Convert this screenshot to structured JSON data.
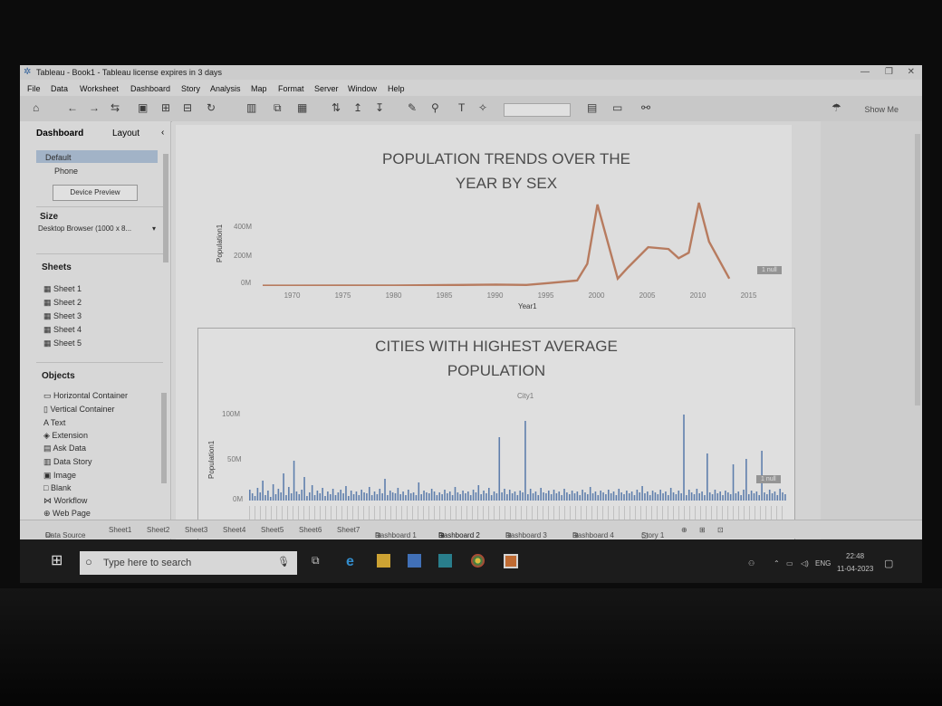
{
  "window": {
    "title": "Tableau - Book1 - Tableau license expires in 3 days"
  },
  "menu": [
    "File",
    "Data",
    "Worksheet",
    "Dashboard",
    "Story",
    "Analysis",
    "Map",
    "Format",
    "Server",
    "Window",
    "Help"
  ],
  "toolbar": {
    "show_me": "Show Me"
  },
  "left_panel": {
    "tab_dashboard": "Dashboard",
    "tab_layout": "Layout",
    "devices": [
      "Default",
      "Phone"
    ],
    "device_preview": "Device Preview",
    "size_header": "Size",
    "size_value": "Desktop Browser (1000 x 8...",
    "sheets_header": "Sheets",
    "sheets": [
      "Sheet 1",
      "Sheet 2",
      "Sheet 3",
      "Sheet 4",
      "Sheet 5"
    ],
    "objects_header": "Objects",
    "objects": [
      "Horizontal Container",
      "Vertical Container",
      "Text",
      "Extension",
      "Ask Data",
      "Data Story",
      "Image",
      "Blank",
      "Workflow",
      "Web Page"
    ]
  },
  "chart1": {
    "title_line1": "POPULATION TRENDS OVER THE",
    "title_line2": "YEAR BY SEX",
    "y_label": "Population1",
    "x_label": "Year1",
    "y_ticks": [
      "400M",
      "200M",
      "0M"
    ],
    "x_ticks": [
      "1970",
      "1975",
      "1980",
      "1985",
      "1990",
      "1995",
      "2000",
      "2005",
      "2010",
      "2015"
    ],
    "null_badge": "1 null"
  },
  "chart2": {
    "title_line1": "CITIES WITH HIGHEST AVERAGE",
    "title_line2": "POPULATION",
    "header_label": "City1",
    "y_label": "Population1",
    "y_ticks": [
      "100M",
      "50M",
      "0M"
    ],
    "null_badge": "1 null"
  },
  "chart_data": [
    {
      "type": "line",
      "title": "POPULATION TRENDS OVER THE YEAR BY SEX",
      "xlabel": "Year1",
      "ylabel": "Population1",
      "ylim": [
        0,
        450000000
      ],
      "xlim": [
        1967,
        2017
      ],
      "x": [
        1967,
        1970,
        1975,
        1980,
        1985,
        1990,
        1993,
        1995,
        1998,
        1999,
        2000,
        2002,
        2003,
        2005,
        2007,
        2008,
        2009,
        2010,
        2011,
        2013
      ],
      "values": [
        2000000,
        2000000,
        3000000,
        3000000,
        5000000,
        8000000,
        6000000,
        15000000,
        30000000,
        120000000,
        440000000,
        40000000,
        100000000,
        210000000,
        200000000,
        150000000,
        180000000,
        450000000,
        240000000,
        40000000
      ],
      "color": "#d08c6c",
      "legend": ""
    },
    {
      "type": "bar",
      "title": "CITIES WITH HIGHEST AVERAGE POPULATION",
      "ylabel": "Population1",
      "xlabel": "City1",
      "ylim": [
        0,
        110000000
      ],
      "categories_note_visible": "",
      "values": [
        12000000,
        8000000,
        5000000,
        14000000,
        9000000,
        22000000,
        6000000,
        11000000,
        4000000,
        18000000,
        7000000,
        13000000,
        9000000,
        30000000,
        6000000,
        15000000,
        8000000,
        44000000,
        10000000,
        7000000,
        12000000,
        26000000,
        5000000,
        9000000,
        17000000,
        6000000,
        11000000,
        8000000,
        14000000,
        5000000,
        10000000,
        7000000,
        13000000,
        6000000,
        9000000,
        12000000,
        8000000,
        16000000,
        5000000,
        11000000,
        7000000,
        10000000,
        6000000,
        12000000,
        9000000,
        8000000,
        15000000,
        6000000,
        10000000,
        7000000,
        13000000,
        8000000,
        24000000,
        6000000,
        11000000,
        9000000,
        8000000,
        14000000,
        7000000,
        10000000,
        6000000,
        12000000,
        8000000,
        9000000,
        6000000,
        20000000,
        7000000,
        11000000,
        9000000,
        8000000,
        13000000,
        10000000,
        6000000,
        9000000,
        7000000,
        12000000,
        8000000,
        10000000,
        6000000,
        15000000,
        9000000,
        7000000,
        11000000,
        8000000,
        10000000,
        6000000,
        12000000,
        9000000,
        17000000,
        7000000,
        11000000,
        8000000,
        14000000,
        6000000,
        10000000,
        8000000,
        70000000,
        9000000,
        13000000,
        7000000,
        12000000,
        8000000,
        10000000,
        6000000,
        11000000,
        9000000,
        88000000,
        7000000,
        13000000,
        8000000,
        10000000,
        6000000,
        14000000,
        9000000,
        8000000,
        11000000,
        7000000,
        12000000,
        8000000,
        10000000,
        6000000,
        13000000,
        9000000,
        7000000,
        11000000,
        8000000,
        10000000,
        6000000,
        12000000,
        9000000,
        7000000,
        15000000,
        8000000,
        10000000,
        6000000,
        11000000,
        9000000,
        7000000,
        12000000,
        8000000,
        10000000,
        6000000,
        13000000,
        9000000,
        7000000,
        11000000,
        8000000,
        10000000,
        6000000,
        12000000,
        9000000,
        16000000,
        8000000,
        10000000,
        6000000,
        11000000,
        9000000,
        7000000,
        12000000,
        8000000,
        10000000,
        6000000,
        14000000,
        9000000,
        7000000,
        11000000,
        8000000,
        95000000,
        6000000,
        12000000,
        9000000,
        7000000,
        13000000,
        8000000,
        10000000,
        6000000,
        52000000,
        9000000,
        7000000,
        12000000,
        8000000,
        10000000,
        6000000,
        11000000,
        9000000,
        7000000,
        40000000,
        8000000,
        10000000,
        6000000,
        12000000,
        46000000,
        7000000,
        11000000,
        8000000,
        10000000,
        6000000,
        55000000,
        9000000,
        7000000,
        12000000,
        8000000,
        10000000,
        6000000,
        13000000,
        9000000,
        7000000
      ],
      "color": "#6b8fc4"
    }
  ],
  "sheet_tabs": [
    "Data Source",
    "Sheet1",
    "Sheet2",
    "Sheet3",
    "Sheet4",
    "Sheet5",
    "Sheet6",
    "Sheet7",
    "Dashboard 1",
    "Dashboard 2",
    "Dashboard 3",
    "Dashboard 4",
    "Story 1"
  ],
  "taskbar": {
    "search_placeholder": "Type here to search",
    "lang": "ENG",
    "time": "22:48",
    "date": "11-04-2023"
  },
  "colors": {
    "line": "#d08c6c",
    "bar": "#6b8fc4",
    "selection": "#b8cbe2"
  }
}
